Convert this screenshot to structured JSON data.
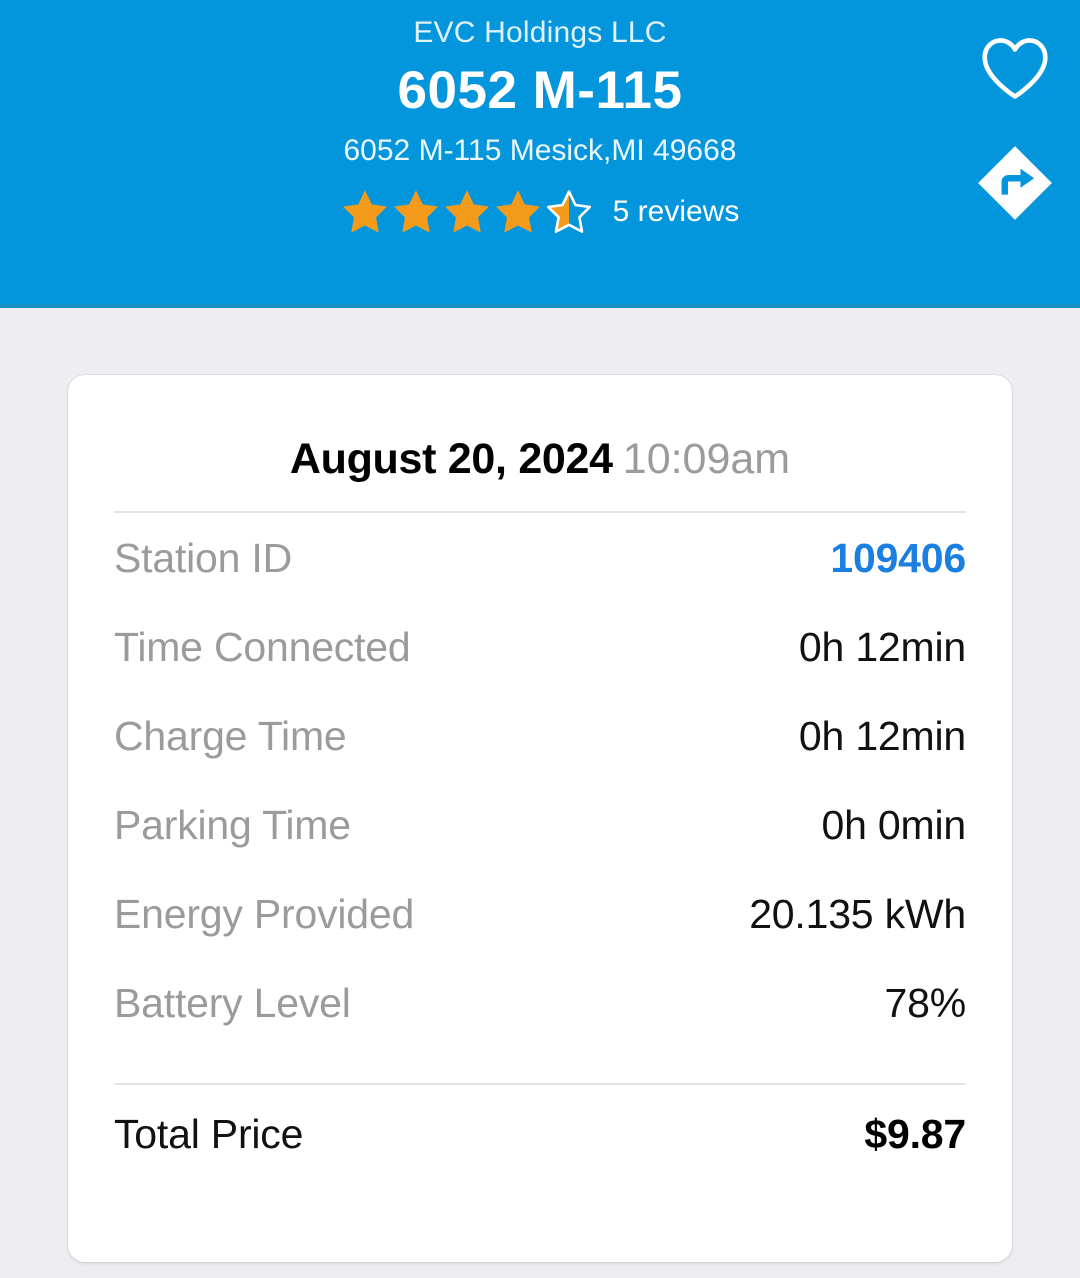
{
  "header": {
    "operator": "EVC Holdings LLC",
    "station_name": "6052 M-115",
    "address": "6052 M-115 Mesick,MI 49668",
    "rating": 4.5,
    "reviews_label": "5 reviews",
    "favorite_icon": "heart-icon",
    "directions_icon": "directions-arrow-icon",
    "bg_color": "#0496dc",
    "star_color": "#f59b1b"
  },
  "session": {
    "date": "August 20, 2024",
    "time": "10:09am",
    "rows": [
      {
        "label": "Station ID",
        "value": "109406",
        "accent": true
      },
      {
        "label": "Time Connected",
        "value": "0h 12min",
        "accent": false
      },
      {
        "label": "Charge Time",
        "value": "0h 12min",
        "accent": false
      },
      {
        "label": "Parking Time",
        "value": "0h 0min",
        "accent": false
      },
      {
        "label": "Energy Provided",
        "value": "20.135 kWh",
        "accent": false
      },
      {
        "label": "Battery Level",
        "value": "78%",
        "accent": false
      }
    ],
    "total_label": "Total Price",
    "total_value": "$9.87",
    "accent_color": "#1a7fe0"
  }
}
